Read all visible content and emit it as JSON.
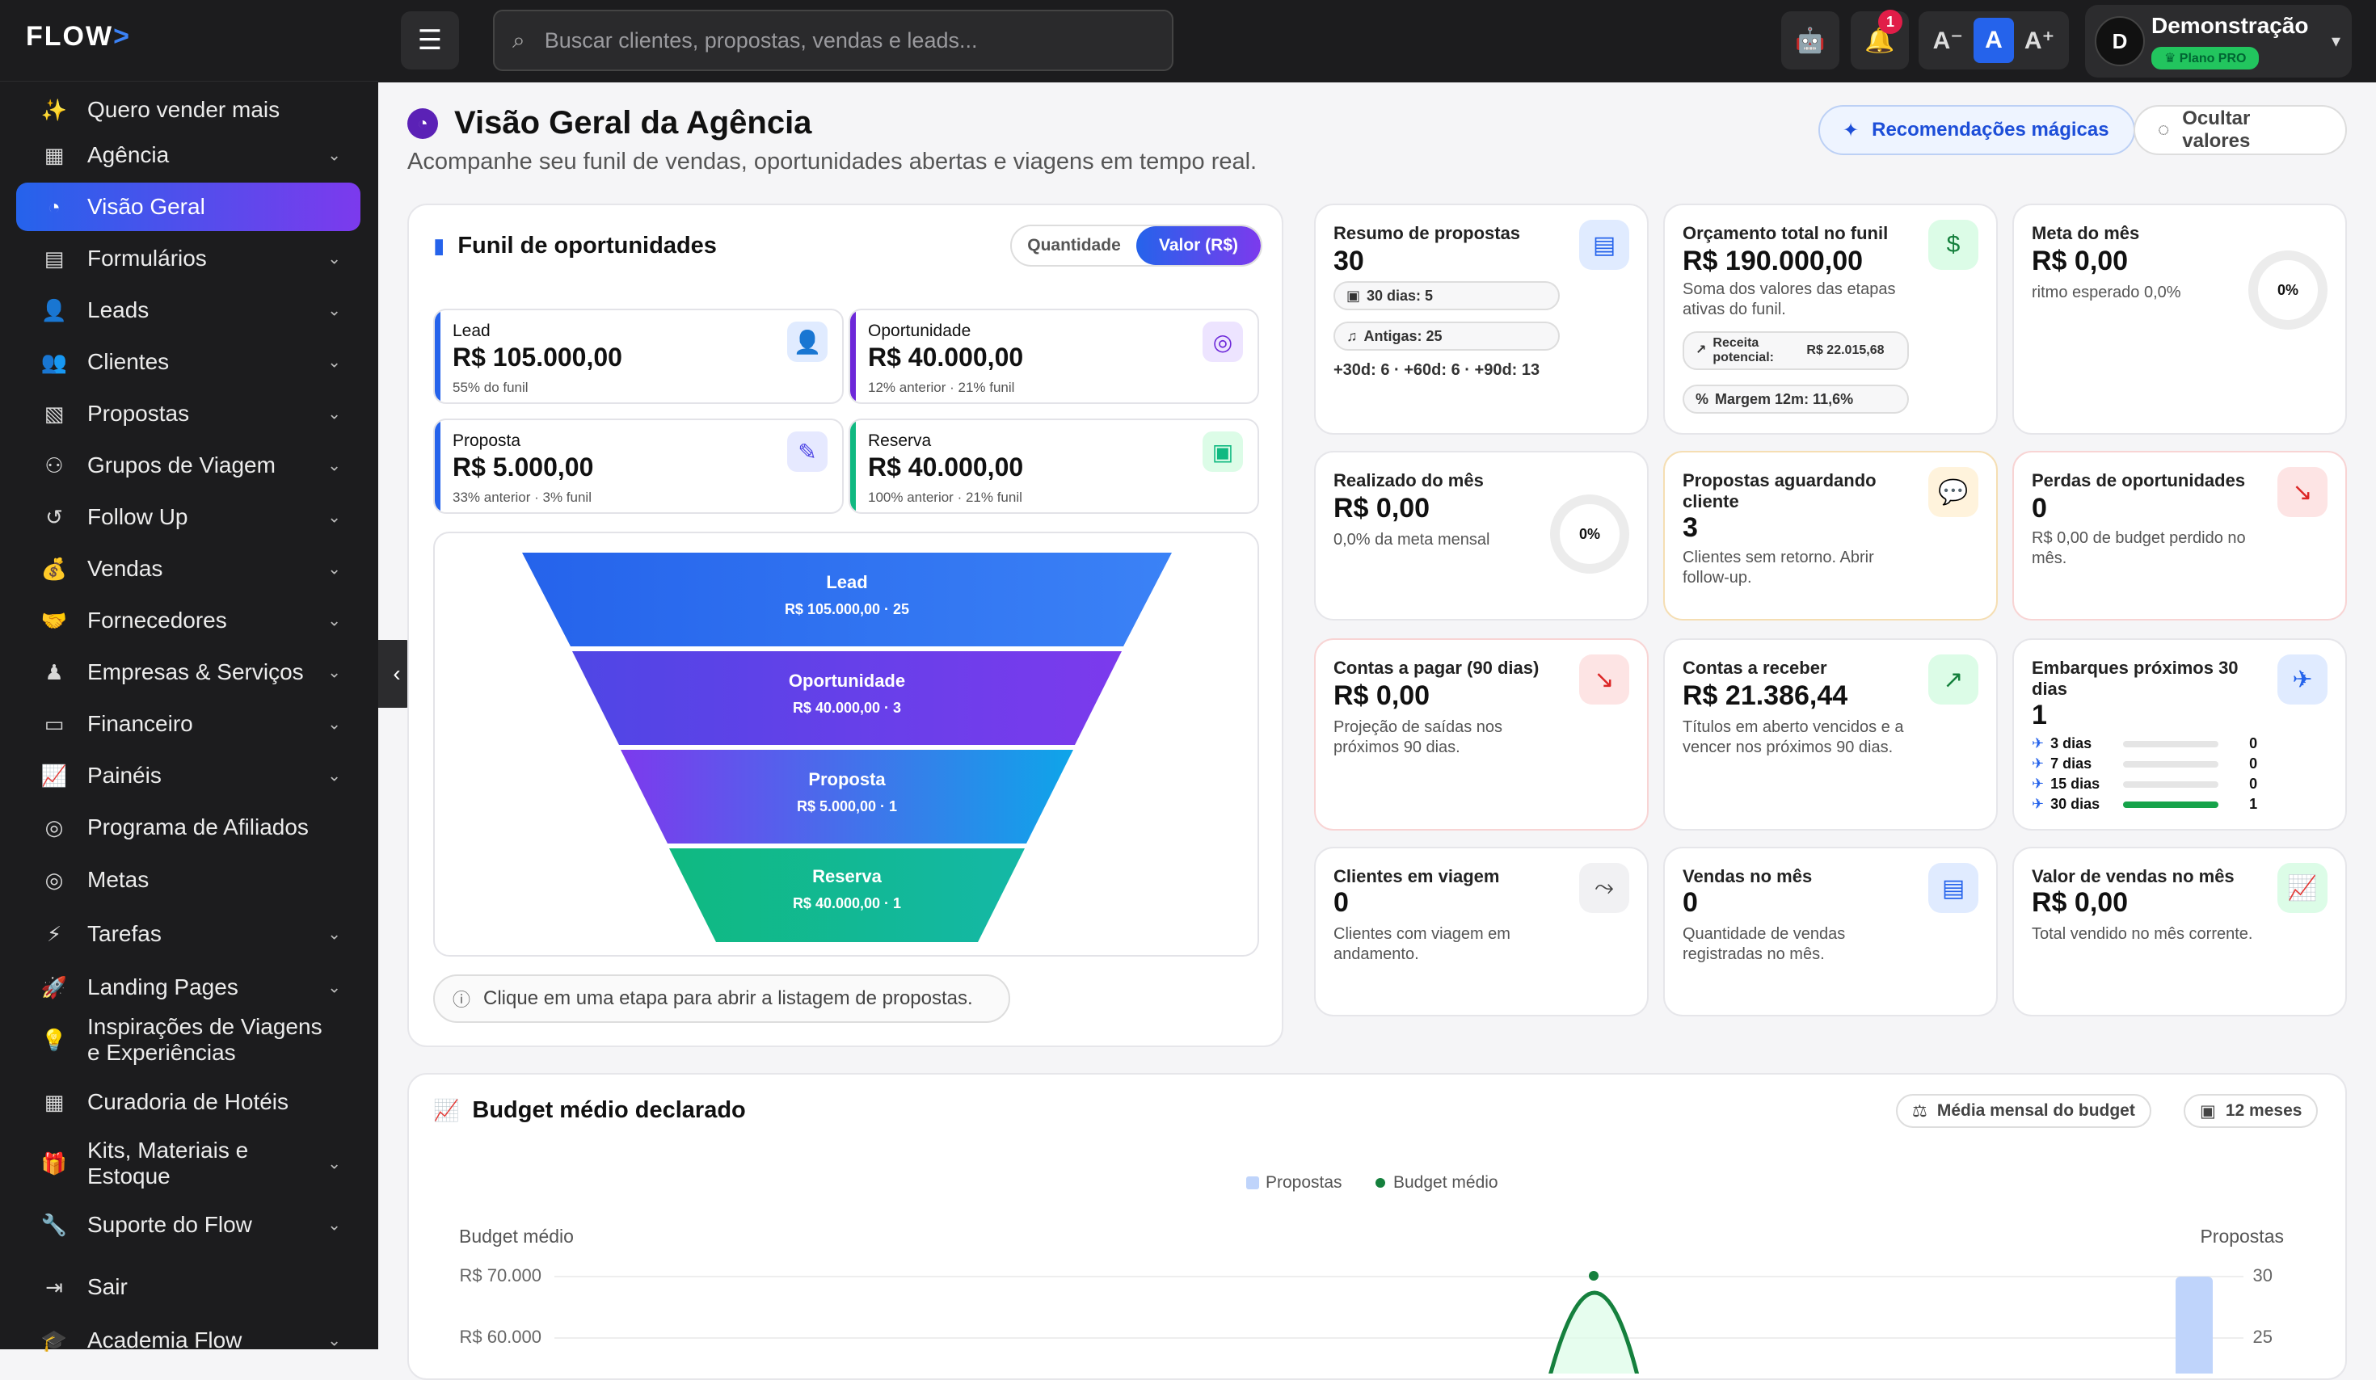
{
  "app": {
    "logo": "FLOW",
    "logo_arrow": ">"
  },
  "sidebar": {
    "items": [
      {
        "label": "Quero vender mais",
        "icon": "magic-wand-icon",
        "glyph": "✨",
        "chevron": false
      },
      {
        "label": "Agência",
        "icon": "building-icon",
        "glyph": "▦",
        "chevron": true
      },
      {
        "label": "Visão Geral",
        "icon": "dashboard-gauge-icon",
        "glyph": "◔",
        "chevron": false,
        "active": true
      },
      {
        "label": "Formulários",
        "icon": "clipboard-icon",
        "glyph": "▤",
        "chevron": true
      },
      {
        "label": "Leads",
        "icon": "user-plus-icon",
        "glyph": "👤",
        "chevron": true
      },
      {
        "label": "Clientes",
        "icon": "users-icon",
        "glyph": "👥",
        "chevron": true
      },
      {
        "label": "Propostas",
        "icon": "file-dollar-icon",
        "glyph": "▧",
        "chevron": true
      },
      {
        "label": "Grupos de Viagem",
        "icon": "people-group-icon",
        "glyph": "⚇",
        "chevron": true
      },
      {
        "label": "Follow Up",
        "icon": "history-icon",
        "glyph": "↺",
        "chevron": true
      },
      {
        "label": "Vendas",
        "icon": "money-bag-icon",
        "glyph": "💰",
        "chevron": true
      },
      {
        "label": "Fornecedores",
        "icon": "handshake-icon",
        "glyph": "🤝",
        "chevron": true
      },
      {
        "label": "Empresas & Serviços",
        "icon": "user-tie-icon",
        "glyph": "♟",
        "chevron": true
      },
      {
        "label": "Financeiro",
        "icon": "wallet-icon",
        "glyph": "▭",
        "chevron": true
      },
      {
        "label": "Painéis",
        "icon": "line-chart-icon",
        "glyph": "📈",
        "chevron": true
      },
      {
        "label": "Programa de Afiliados",
        "icon": "coins-icon",
        "glyph": "◎",
        "chevron": false
      },
      {
        "label": "Metas",
        "icon": "target-icon",
        "glyph": "◎",
        "chevron": false
      },
      {
        "label": "Tarefas",
        "icon": "lightning-icon",
        "glyph": "⚡",
        "chevron": true
      },
      {
        "label": "Landing Pages",
        "icon": "rocket-icon",
        "glyph": "🚀",
        "chevron": true
      },
      {
        "label": "Inspirações de Viagens e Experiências",
        "icon": "lightbulb-icon",
        "glyph": "💡",
        "chevron": false
      },
      {
        "label": "Curadoria de Hotéis",
        "icon": "hotel-icon",
        "glyph": "▦",
        "chevron": false
      },
      {
        "label": "Kits, Materiais e Estoque",
        "icon": "gift-icon",
        "glyph": "🎁",
        "chevron": true
      },
      {
        "label": "Suporte do Flow",
        "icon": "wrench-icon",
        "glyph": "🔧",
        "chevron": true
      },
      {
        "label": "Sair",
        "icon": "logout-icon",
        "glyph": "⇥",
        "chevron": false
      },
      {
        "label": "Academia Flow",
        "icon": "graduation-cap-icon",
        "glyph": "🎓",
        "chevron": true
      }
    ]
  },
  "topbar": {
    "search_placeholder": "Buscar clientes, propostas, vendas e leads...",
    "notifications_count": "1",
    "font_controls": [
      "A⁻",
      "A",
      "A⁺"
    ],
    "user": {
      "initial": "D",
      "name": "Demonstração",
      "plan": "Plano PRO"
    }
  },
  "page": {
    "title": "Visão Geral da Agência",
    "subtitle": "Acompanhe seu funil de vendas, oportunidades abertas e viagens em tempo real.",
    "btn_recommend": "Recomendações mágicas",
    "btn_hide": "Ocultar valores"
  },
  "funnel": {
    "title": "Funil de oportunidades",
    "toggle": {
      "quantity": "Quantidade",
      "value": "Valor (R$)",
      "selected": "value"
    },
    "stages": [
      {
        "name": "Lead",
        "value": "R$ 105.000,00",
        "note": "55% do funil",
        "color": "#2563eb",
        "icon": "user-plus-icon",
        "glyph": "👤",
        "icon_bg": "#e0ebff",
        "icon_color": "#2563eb"
      },
      {
        "name": "Oportunidade",
        "value": "R$ 40.000,00",
        "note": "12% anterior · 21% funil",
        "color": "#6d28d9",
        "icon": "target-icon",
        "glyph": "◎",
        "icon_bg": "#ede4ff",
        "icon_color": "#6d28d9"
      },
      {
        "name": "Proposta",
        "value": "R$ 5.000,00",
        "note": "33% anterior · 3% funil",
        "color": "#2563eb",
        "icon": "edit-document-icon",
        "glyph": "✎",
        "icon_bg": "#e6e9ff",
        "icon_color": "#4f46e5"
      },
      {
        "name": "Reserva",
        "value": "R$ 40.000,00",
        "note": "100% anterior · 21% funil",
        "color": "#10b981",
        "icon": "calendar-check-icon",
        "glyph": "▣",
        "icon_bg": "#dcfce7",
        "icon_color": "#10b981"
      }
    ],
    "levels": [
      {
        "label": "Lead",
        "sub": "R$ 105.000,00 · 25"
      },
      {
        "label": "Oportunidade",
        "sub": "R$ 40.000,00 · 3"
      },
      {
        "label": "Proposta",
        "sub": "R$ 5.000,00 · 1"
      },
      {
        "label": "Reserva",
        "sub": "R$ 40.000,00 · 1"
      }
    ],
    "hint": "Clique em uma etapa para abrir a listagem de propostas."
  },
  "kpis": {
    "resumo": {
      "title": "Resumo de propostas",
      "value": "30",
      "pill1": "30 dias: 5",
      "pill2": "Antigas: 25",
      "detail": "+30d: 6 · +60d: 6 · +90d: 13"
    },
    "orcamento": {
      "title": "Orçamento total no funil",
      "value": "R$ 190.000,00",
      "desc": "Soma dos valores das etapas ativas do funil.",
      "pill1_label": "Receita potencial:",
      "pill1_value": "R$ 22.015,68",
      "pill2": "Margem 12m: 11,6%"
    },
    "meta": {
      "title": "Meta do mês",
      "value": "R$ 0,00",
      "desc": "ritmo esperado 0,0%",
      "percent": "0%"
    },
    "realizado": {
      "title": "Realizado do mês",
      "value": "R$ 0,00",
      "desc": "0,0% da meta mensal",
      "percent": "0%"
    },
    "aguardando": {
      "title": "Propostas aguardando cliente",
      "value": "3",
      "desc": "Clientes sem retorno. Abrir follow-up."
    },
    "perdas": {
      "title": "Perdas de oportunidades",
      "value": "0",
      "desc": "R$ 0,00 de budget perdido no mês."
    },
    "pagar": {
      "title": "Contas a pagar (90 dias)",
      "value": "R$ 0,00",
      "desc": "Projeção de saídas nos próximos 90 dias."
    },
    "receber": {
      "title": "Contas a receber",
      "value": "R$ 21.386,44",
      "desc": "Títulos em aberto vencidos e a vencer nos próximos 90 dias."
    },
    "embarques": {
      "title": "Embarques próximos 30 dias",
      "value": "1",
      "rows": [
        {
          "label": "3 dias",
          "count": "0",
          "fill": 0
        },
        {
          "label": "7 dias",
          "count": "0",
          "fill": 0
        },
        {
          "label": "15 dias",
          "count": "0",
          "fill": 0
        },
        {
          "label": "30 dias",
          "count": "1",
          "fill": 1
        }
      ]
    },
    "viagem": {
      "title": "Clientes em viagem",
      "value": "0",
      "desc": "Clientes com viagem em andamento."
    },
    "vendas": {
      "title": "Vendas no mês",
      "value": "0",
      "desc": "Quantidade de vendas registradas no mês."
    },
    "valor_vendas": {
      "title": "Valor de vendas no mês",
      "value": "R$ 0,00",
      "desc": "Total vendido no mês corrente."
    }
  },
  "budget": {
    "title": "Budget médio declarado",
    "chip1": "Média mensal do budget",
    "chip2": "12 meses",
    "legend": [
      "Propostas",
      "Budget médio"
    ],
    "left_axis_label": "Budget médio",
    "right_axis_label": "Propostas",
    "left_ticks": [
      "R$ 70.000",
      "R$ 60.000"
    ],
    "right_ticks": [
      "30",
      "25"
    ],
    "colors": {
      "propostas": "#bfd4fb",
      "budget": "#15803d"
    }
  }
}
